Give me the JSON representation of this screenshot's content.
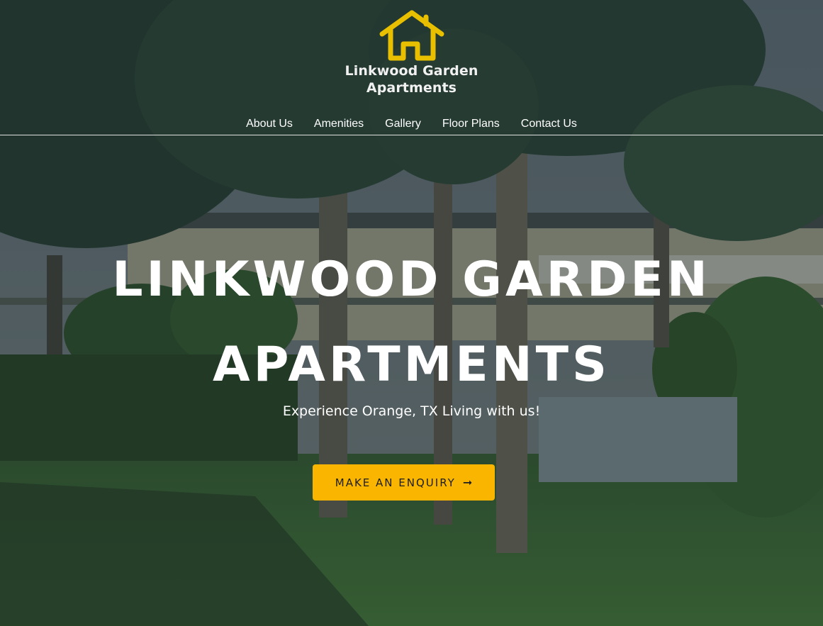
{
  "brand": {
    "logo_line1": "Linkwood Garden",
    "logo_line2": "Apartments",
    "logo_icon": "house-icon",
    "accent_color": "#e8c000"
  },
  "nav": {
    "items": [
      {
        "label": "About Us"
      },
      {
        "label": "Amenities"
      },
      {
        "label": "Gallery"
      },
      {
        "label": "Floor Plans"
      },
      {
        "label": "Contact Us"
      }
    ]
  },
  "hero": {
    "title_line1": "LINKWOOD GARDEN",
    "title_line2": "APARTMENTS",
    "subtitle": "Experience Orange, TX Living with us!",
    "cta_label": "MAKE AN ENQUIRY",
    "cta_icon": "arrow-right-icon",
    "cta_arrow": "➞",
    "cta_color": "#f9b500"
  }
}
